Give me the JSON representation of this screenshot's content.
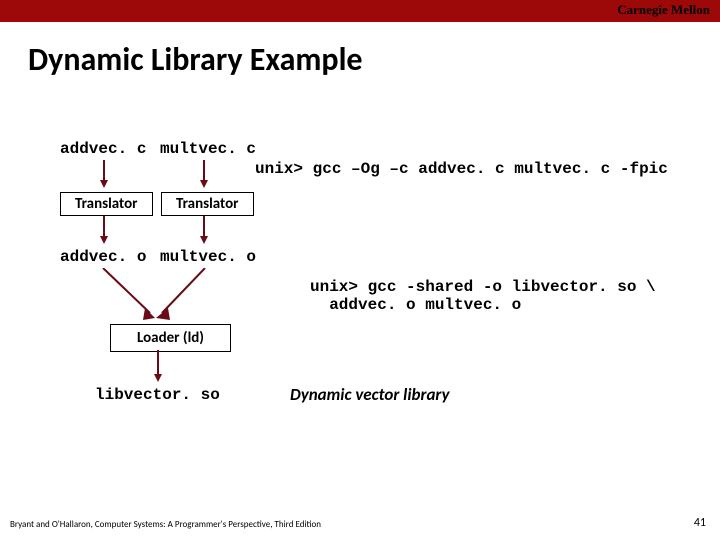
{
  "header": {
    "org": "Carnegie Mellon"
  },
  "title": "Dynamic Library Example",
  "files": {
    "addvec_c": "addvec. c",
    "multvec_c": "multvec. c",
    "addvec_o": "addvec. o",
    "multvec_o": "multvec. o",
    "libvector_so": "libvector. so"
  },
  "boxes": {
    "translator1": "Translator",
    "translator2": "Translator",
    "loader": "Loader (ld)"
  },
  "commands": {
    "compile": "unix> gcc –Og –c addvec. c multvec. c -fpic",
    "link1": "unix> gcc -shared -o libvector. so \\",
    "link2": "  addvec. o multvec. o"
  },
  "notes": {
    "dynlib": "Dynamic vector library"
  },
  "footer": {
    "credits": "Bryant and O'Hallaron, Computer Systems: A Programmer's Perspective, Third Edition",
    "page": "41"
  }
}
